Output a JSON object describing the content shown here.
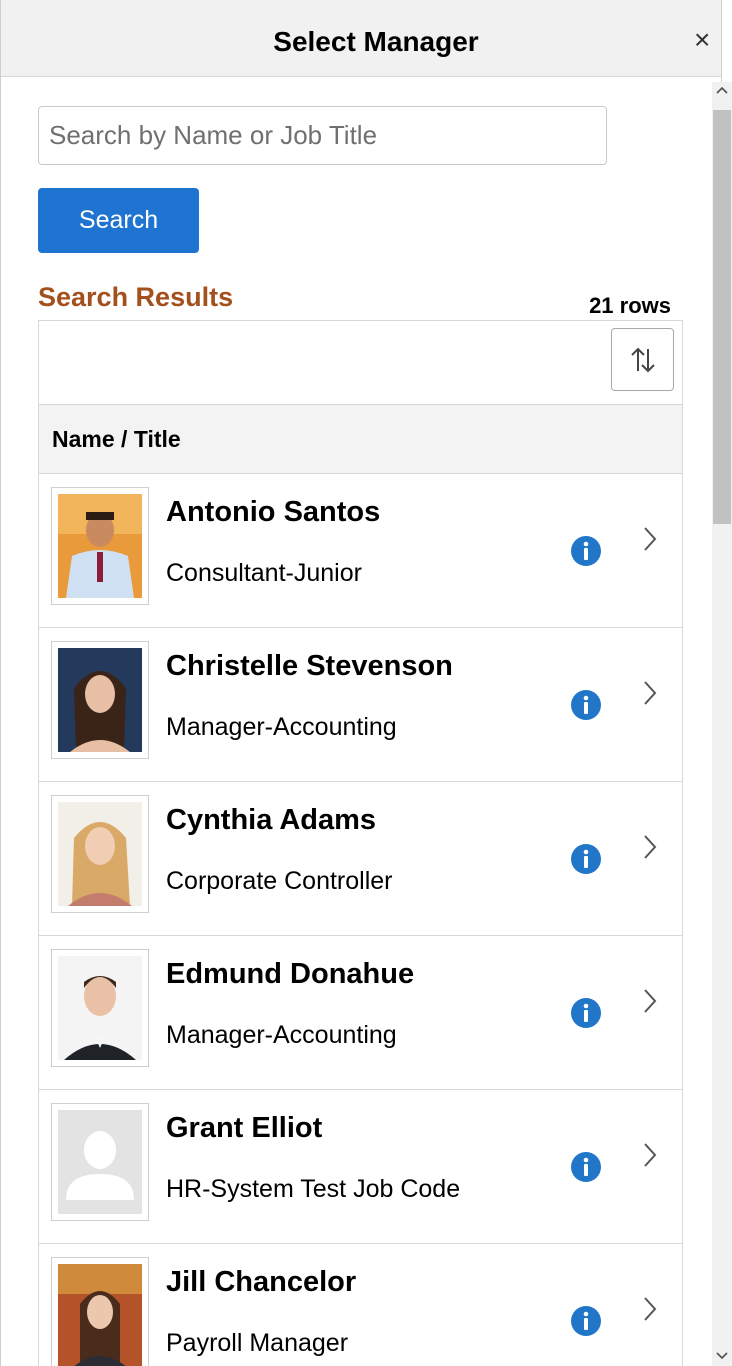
{
  "dialog": {
    "title": "Select Manager",
    "close_glyph": "×"
  },
  "search": {
    "placeholder": "Search by Name or Job Title",
    "value": "",
    "button_label": "Search"
  },
  "results": {
    "heading": "Search Results",
    "count": "21 rows",
    "column_header": "Name / Title",
    "rows": [
      {
        "name": "Antonio Santos",
        "title": "Consultant-Junior",
        "photo": "photo-man-orange-background"
      },
      {
        "name": "Christelle Stevenson",
        "title": "Manager-Accounting",
        "photo": "photo-woman-dark-hair"
      },
      {
        "name": "Cynthia Adams",
        "title": "Corporate Controller",
        "photo": "photo-woman-blonde"
      },
      {
        "name": "Edmund Donahue",
        "title": "Manager-Accounting",
        "photo": "photo-man-suit"
      },
      {
        "name": "Grant Elliot",
        "title": "HR-System Test Job Code",
        "photo": "placeholder-person-icon"
      },
      {
        "name": "Jill Chancelor",
        "title": "Payroll Manager",
        "photo": "photo-woman-office"
      }
    ]
  },
  "icons": {
    "info": "info-icon",
    "chevron": "chevron-right-icon",
    "sort": "sort-icon"
  },
  "colors": {
    "accent": "#1f73d1",
    "results_heading": "#a3501c",
    "info_icon": "#2176c7"
  }
}
